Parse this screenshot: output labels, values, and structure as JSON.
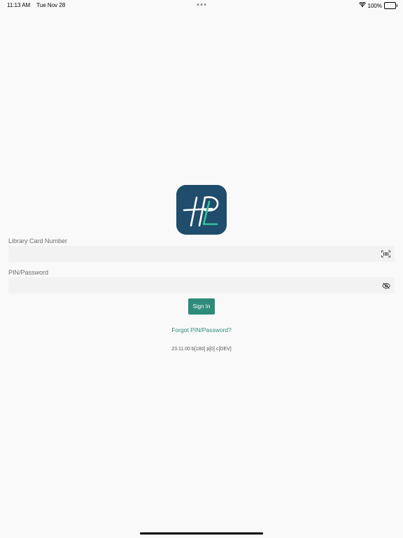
{
  "status_bar": {
    "time": "11:13 AM",
    "date": "Tue Nov 28",
    "battery": "100%"
  },
  "logo": {
    "icon": "hpl-logo-icon",
    "background_color": "#1f4d6b",
    "accent_color": "#33c2a0"
  },
  "form": {
    "card_label": "Library Card Number",
    "card_value": "",
    "card_icon": "barcode-scan-icon",
    "pin_label": "PIN/Password",
    "pin_value": "",
    "pin_icon": "eye-slash-icon",
    "sign_in_label": "Sign In",
    "forgot_label": "Forgot PIN/Password?"
  },
  "version": "23.11.00 b[180] p[0] c[DEV]",
  "colors": {
    "accent": "#2e8b7a",
    "background": "#f9f9f9",
    "field": "#f2f2f2"
  }
}
